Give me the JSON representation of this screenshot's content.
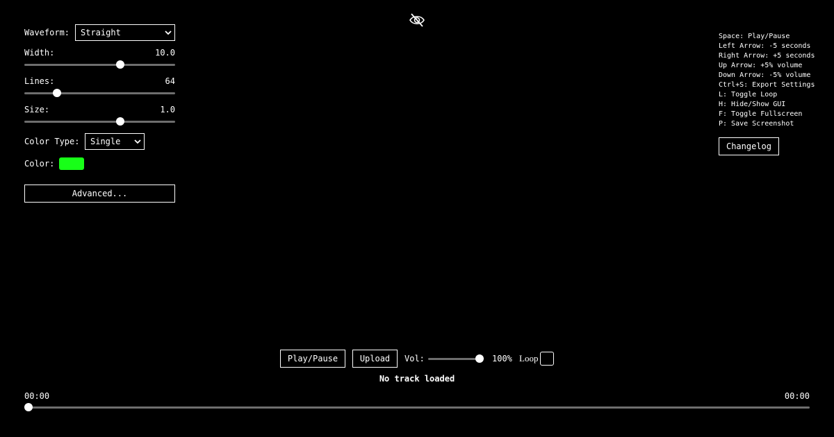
{
  "controls": {
    "waveform": {
      "label": "Waveform:",
      "selected": "Straight"
    },
    "width": {
      "label": "Width:",
      "value": "10.0",
      "fraction": 0.636
    },
    "lines": {
      "label": "Lines:",
      "value": "64",
      "fraction": 0.217
    },
    "size": {
      "label": "Size:",
      "value": "1.0",
      "fraction": 0.636
    },
    "color_type": {
      "label": "Color Type:",
      "selected": "Single"
    },
    "color": {
      "label": "Color:",
      "hex": "#18ff18"
    },
    "advanced_label": "Advanced..."
  },
  "shortcuts": [
    "Space: Play/Pause",
    "Left Arrow: -5 seconds",
    "Right Arrow: +5 seconds",
    "Up Arrow: +5% volume",
    "Down Arrow: -5% volume",
    "Ctrl+S: Export Settings",
    "L: Toggle Loop",
    "H: Hide/Show GUI",
    "F: Toggle Fullscreen",
    "P: Save Screenshot"
  ],
  "changelog_label": "Changelog",
  "player": {
    "play_pause_label": "Play/Pause",
    "upload_label": "Upload",
    "volume_label": "Vol:",
    "volume_value": "100%",
    "volume_fraction": 1.0,
    "loop_label": "Loop",
    "loop_checked": false,
    "status": "No track loaded",
    "current_time": "00:00",
    "total_time": "00:00",
    "progress_fraction": 0.0
  },
  "icons": {
    "gui_toggle": "eye-slash-icon",
    "select_arrow": "chevron-down-icon"
  }
}
